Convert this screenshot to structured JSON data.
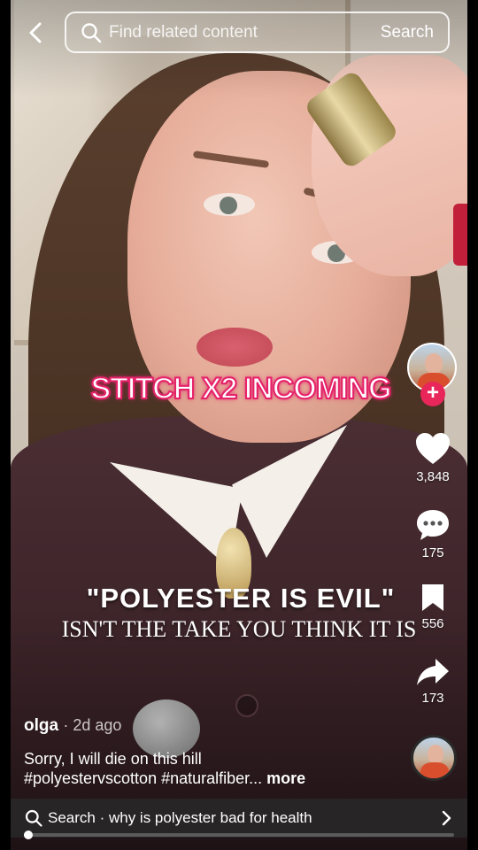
{
  "top_bar": {
    "search_placeholder": "Find related content",
    "search_button": "Search"
  },
  "video_overlay": {
    "stitch_text": "STITCH X2 INCOMING",
    "headline": "\"POLYESTER IS EVIL\"",
    "subheadline": "ISN'T THE TAKE YOU THINK IT IS"
  },
  "rail": {
    "likes": "3,848",
    "comments": "175",
    "saves": "556",
    "shares": "173"
  },
  "post": {
    "author": "olga",
    "meta": "· 2d ago",
    "caption_line1": "Sorry, I will die on this hill",
    "caption_line2": "#polyestervscotton #naturalfiber...",
    "more": "more"
  },
  "bottom_search": {
    "label": "Search · why is polyester bad for health"
  },
  "playback": {
    "progress": 0.01
  },
  "colors": {
    "accent": "#e8265a",
    "stitch_outline": "#e5226a"
  },
  "icons": [
    "back-arrow-icon",
    "search-icon",
    "heart-icon",
    "comment-bubble-icon",
    "bookmark-icon",
    "share-arrow-icon",
    "chevron-right-icon",
    "plus-icon"
  ]
}
